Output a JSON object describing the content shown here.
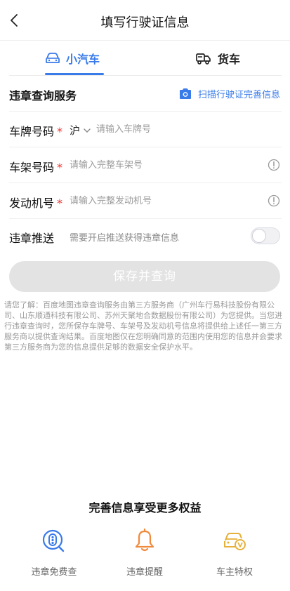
{
  "header": {
    "title": "填写行驶证信息"
  },
  "tabs": [
    {
      "label": "小汽车"
    },
    {
      "label": "货车"
    }
  ],
  "section": {
    "label": "违章查询服务",
    "scan_label": "扫描行驶证完善信息"
  },
  "form": {
    "plate": {
      "label": "车牌号码",
      "required_mark": "*",
      "province": "沪",
      "placeholder": "请输入车牌号"
    },
    "vin": {
      "label": "车架号码",
      "required_mark": "*",
      "placeholder": "请输入完整车架号"
    },
    "engine": {
      "label": "发动机号",
      "required_mark": "*",
      "placeholder": "请输入完整发动机号"
    },
    "push": {
      "label": "违章推送",
      "hint": "需要开启推送获得违章信息",
      "enabled": false
    }
  },
  "save_button": "保存并查询",
  "notice": "请您了解：百度地图违章查询服务由第三方服务商（广州车行易科技股份有限公司、山东顺通科技有限公司、苏州天聚地合数据股份有限公司）为您提供。当您进行违章查询时，您所保存车牌号、车架号及发动机号信息将提供给上述任一第三方服务商以提供查询结果。百度地图仅在您明确同意的范围内使用您的信息并会要求第三方服务商为您的信息提供足够的数据安全保护水平。",
  "benefits": {
    "title": "完善信息享受更多权益",
    "items": [
      {
        "label": "违章免费查",
        "icon": "search-badge-icon"
      },
      {
        "label": "违章提醒",
        "icon": "bell-icon"
      },
      {
        "label": "车主特权",
        "icon": "car-vip-icon"
      }
    ]
  },
  "colors": {
    "accent": "#3a7bea",
    "required": "#e33333",
    "bell": "#f08a3c",
    "vip": "#e6b13a"
  }
}
